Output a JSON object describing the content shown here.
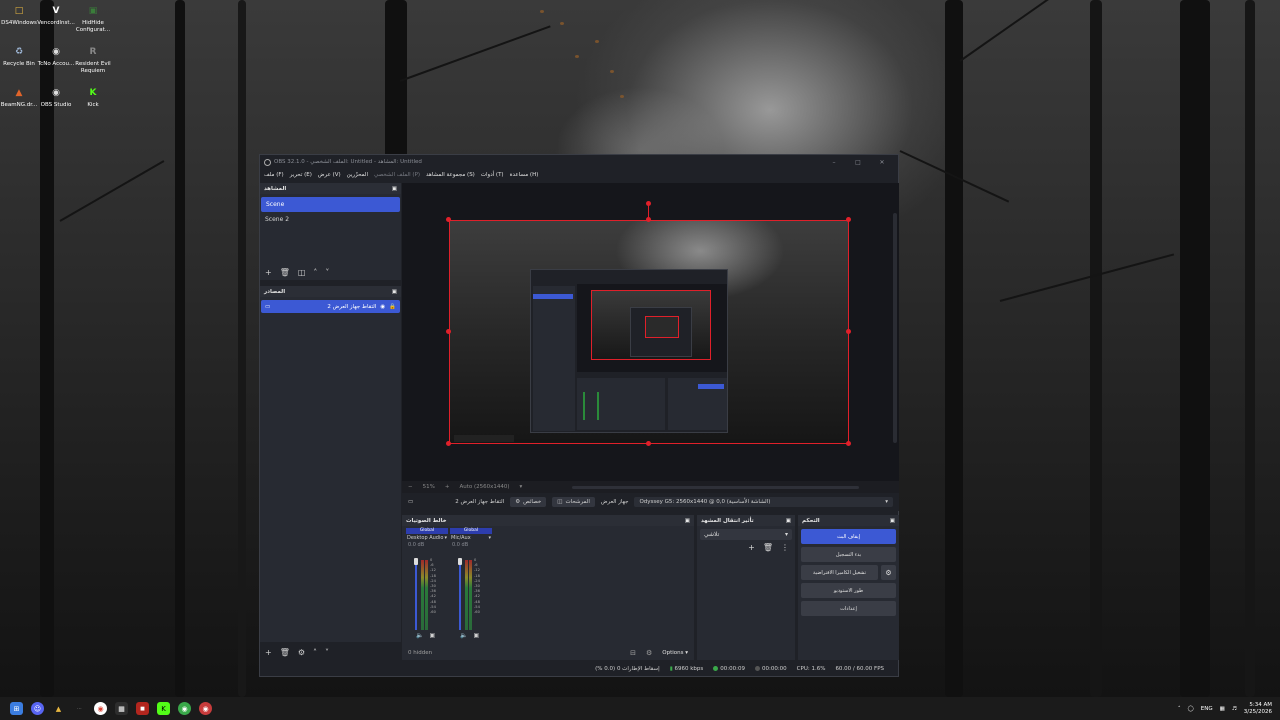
{
  "desktop": {
    "icons": [
      {
        "label": "DS4Windows",
        "icon": "folder-icon",
        "color": "#e8b740"
      },
      {
        "label": "VencordInst...",
        "icon": "vencord-icon",
        "color": "#ffffff"
      },
      {
        "label": "HidHide Configurat...",
        "icon": "hidhide-icon",
        "color": "#3a7d3a"
      },
      {
        "label": "Recycle Bin",
        "icon": "recycle-bin-icon",
        "color": "#9fb8d8"
      },
      {
        "label": "TcNo Accou...",
        "icon": "tcno-icon",
        "color": "#dddddd"
      },
      {
        "label": "Resident Evil Requiem",
        "icon": "resident-evil-icon",
        "color": "#888888"
      },
      {
        "label": "BeamNG.dr...",
        "icon": "beamng-icon",
        "color": "#e0642a"
      },
      {
        "label": "OBS Studio",
        "icon": "obs-icon",
        "color": "#dddddd"
      },
      {
        "label": "Kick",
        "icon": "kick-icon",
        "color": "#53fc18"
      }
    ]
  },
  "obs": {
    "title": "OBS 32.1.0 - الملف الشخصي: Untitled - المشاهد: Untitled",
    "menu": [
      "ملف (F)",
      "تحرير (E)",
      "عرض (V)",
      "المحرّرين",
      "الملف الشخصي (P)",
      "مجموعة المشاهد (S)",
      "أدوات (T)",
      "مساعدة (H)"
    ],
    "scenes": {
      "title": "المشاهد",
      "items": [
        "Scene",
        "Scene 2"
      ]
    },
    "sources": {
      "title": "المصادر",
      "items": [
        "التقاط جهاز العرض 2"
      ]
    },
    "preview": {
      "zoom": "51%",
      "resolution": "Auto (2560x1440)"
    },
    "source_toolbar": {
      "source_name": "التقاط جهاز العرض 2",
      "properties": "خصائص",
      "filters": "المرشحات",
      "display_label": "جهاز العرض",
      "display_value": "Odyssey G5: 2560x1440 @ 0,0 (الشاشة الأساسية)"
    },
    "mixer": {
      "title": "خالط الصوتيات",
      "channels": [
        {
          "scope": "Global",
          "name": "Desktop Audio",
          "db": "0.0 dB"
        },
        {
          "scope": "Global",
          "name": "Mic/Aux",
          "db": "0.0 dB"
        }
      ],
      "scale": [
        "0",
        "-6",
        "-12",
        "-18",
        "-24",
        "-30",
        "-36",
        "-42",
        "-48",
        "-54",
        "-60"
      ],
      "hidden": "0 hidden",
      "options": "Options"
    },
    "transitions": {
      "title": "تأثير انتقال المشهد",
      "value": "تلاشي"
    },
    "controls": {
      "title": "التحكم",
      "buttons": [
        "إيقاف البث",
        "بدء التسجيل",
        "تشغيل الكاميرا الافتراضية",
        "طور الاستوديو",
        "إعدادات"
      ]
    },
    "status": {
      "dropped": "إسقاط الإطارات 0 (0.0 %)",
      "bitrate": "6960 kbps",
      "stream_time": "00:00:09",
      "rec_time": "00:00:00",
      "cpu": "CPU: 1.6%",
      "fps": "60.00 / 60.00 FPS"
    }
  },
  "taskbar": {
    "lang": "ENG",
    "time": "5:34 AM",
    "date": "3/25/2026"
  },
  "colors": {
    "accent": "#3c59d4",
    "selection_red": "#e0202a"
  }
}
